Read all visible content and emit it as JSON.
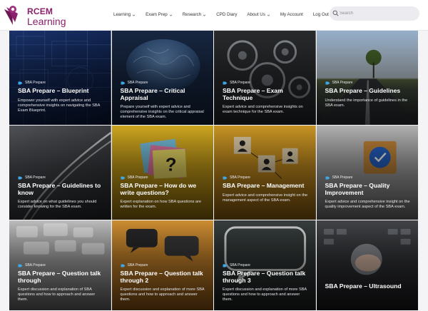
{
  "brand": {
    "name_line1": "RCEM",
    "name_line2": "Learning",
    "color": "#8a1f6b"
  },
  "nav": {
    "items": [
      {
        "label": "Learning",
        "dropdown": true
      },
      {
        "label": "Exam Prep",
        "dropdown": true
      },
      {
        "label": "Research",
        "dropdown": true
      },
      {
        "label": "CPD Diary",
        "dropdown": false
      },
      {
        "label": "About Us",
        "dropdown": true
      },
      {
        "label": "My Account",
        "dropdown": false
      },
      {
        "label": "Log Out",
        "dropdown": false
      }
    ]
  },
  "search": {
    "placeholder": "Search",
    "value": ""
  },
  "cards": [
    {
      "tag": "SBA Prepare",
      "title": "SBA Prepare – Blueprint",
      "desc": "Empower yourself with expert advice and comprehensive insights on navigating the SBA Exam Blueprint."
    },
    {
      "tag": "SBA Prepare",
      "title": "SBA Prepare – Critical Appraisal",
      "desc": "Prepare yourself with expert advice and comprehensive insights on the critical appraisal element of the SBA exam."
    },
    {
      "tag": "SBA Prepare",
      "title": "SBA Prepare – Exam Technique",
      "desc": "Expert advice and comprehensive insights on exam technique for the SBA exam."
    },
    {
      "tag": "SBA Prepare",
      "title": "SBA Prepare – Guidelines",
      "desc": "Understand the importance of guidelines in the SBA exam."
    },
    {
      "tag": "SBA Prepare",
      "title": "SBA Prepare – Guidelines to know",
      "desc": "Expert advice on what guidelines you should consider knowing for the SBA exam."
    },
    {
      "tag": "SBA Prepare",
      "title": "SBA Prepare – How do we write questions?",
      "desc": "Expert explanation on how SBA questions are written for the exam."
    },
    {
      "tag": "SBA Prepare",
      "title": "SBA Prepare – Management",
      "desc": "Expert advice and comprehensive insight on the management aspect of the SBA exam."
    },
    {
      "tag": "SBA Prepare",
      "title": "SBA Prepare – Quality Improvement",
      "desc": "Expert advice and comprehensive insight on the quality improvement aspect of the SBA exam."
    },
    {
      "tag": "SBA Prepare",
      "title": "SBA Prepare – Question talk through",
      "desc": "Expert discussion and explanation of SBA questions and how to approach and answer them."
    },
    {
      "tag": "SBA Prepare",
      "title": "SBA Prepare – Question talk through 2",
      "desc": "Expert discussion and explanation of more SBA questions and how to approach and answer them."
    },
    {
      "tag": "SBA Prepare",
      "title": "SBA Prepare – Question talk through 3",
      "desc": "Expert discussion and explanation of more SBA questions and how to approach and answer them."
    },
    {
      "tag": "SBA Prepare",
      "title": "SBA Prepare – Ultrasound",
      "desc": ""
    }
  ],
  "colors": {
    "tag_icon": "#3fa7e8",
    "text_light": "#ffffff"
  }
}
